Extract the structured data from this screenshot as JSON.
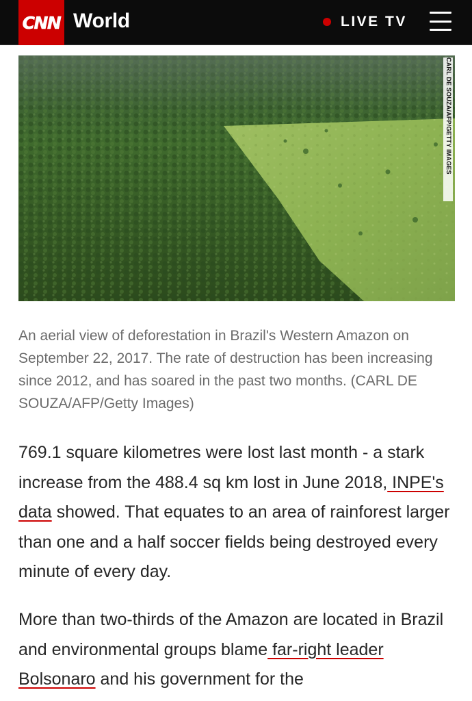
{
  "header": {
    "logo_text": "CNN",
    "section": "World",
    "live_label": "LIVE TV",
    "brand_color": "#cc0000",
    "background": "#0c0c0c",
    "menu_icon": "hamburger-menu-icon"
  },
  "hero": {
    "credit": "CARL DE SOUZA/AFP/GETTY IMAGES"
  },
  "caption": "An aerial view of deforestation in Brazil's Western Amazon on September 22, 2017. The rate of destruction has been increasing since 2012, and has soared in the past two months. (CARL DE SOUZA/AFP/Getty Images)",
  "article": {
    "p1_before": "769.1 square kilometres were lost last month - a stark increase from the 488.4 sq km lost in June 2018,",
    "p1_link": " INPE's data",
    "p1_after": " showed. That equates to an area of rainforest larger than one and a half soccer fields being destroyed every minute of every day.",
    "p2_before": "More than two-thirds of the Amazon are located in Brazil and environmental groups blame",
    "p2_link": " far-right leader Bolsonaro",
    "p2_after": " and his government for the"
  }
}
